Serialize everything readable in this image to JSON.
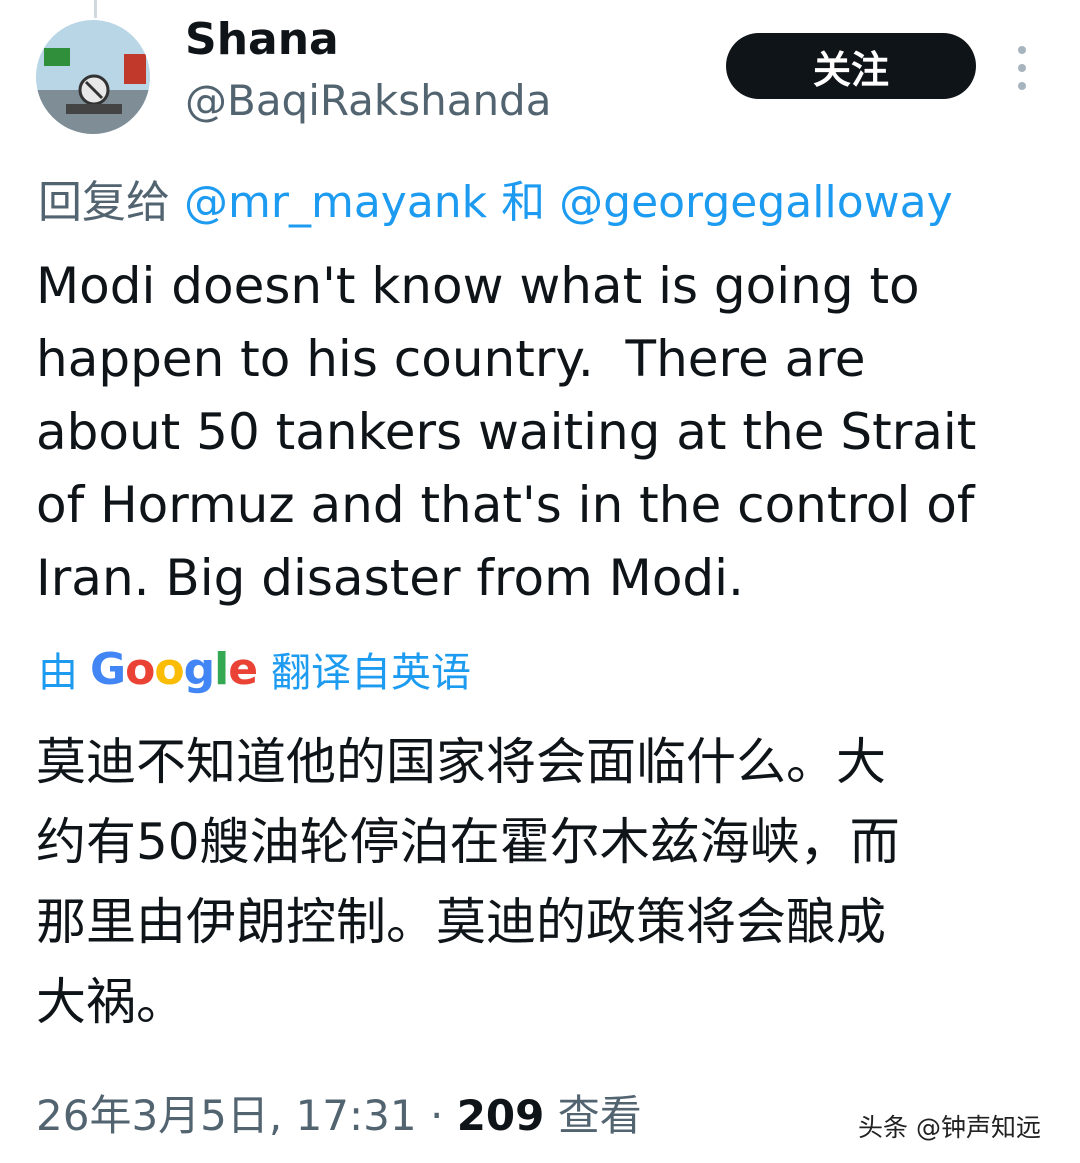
{
  "tweet": {
    "author": {
      "display_name": "Shana",
      "handle": "@BaqiRakshanda"
    },
    "follow_label": "关注",
    "more_icon": "more-vertical-icon",
    "reply": {
      "prefix": "回复给 ",
      "user1": "@mr_mayank",
      "joiner": " 和 ",
      "user2": "@georgegalloway"
    },
    "text": "Modi doesn't know what is going to\nhappen to his country.  There are\nabout 50 tankers waiting at the Strait\nof Hormuz and that's in the control of\nIran. Big disaster from Modi.",
    "translation": {
      "prefix": "由",
      "provider": "Google",
      "suffix": "翻译自英语",
      "text": "莫迪不知道他的国家将会面临什么。大\n约有50艘油轮停泊在霍尔木兹海峡，而\n那里由伊朗控制。莫迪的政策将会酿成\n大祸。"
    },
    "meta": {
      "datetime": "26年3月5日, 17:31 · ",
      "views_count": "209",
      "views_label": " 查看"
    }
  },
  "watermark": "头条 @钟声知远",
  "colors": {
    "link": "#1d9bf0",
    "secondary": "#536471",
    "primary": "#0f1419",
    "button_bg": "#0f1419"
  }
}
